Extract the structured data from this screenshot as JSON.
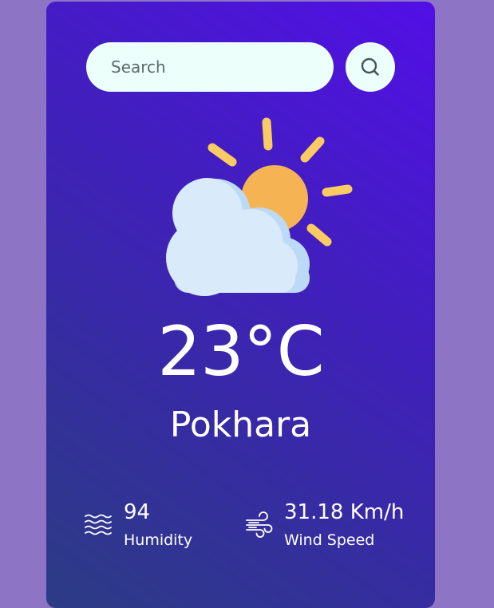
{
  "search": {
    "placeholder": "Search",
    "value": ""
  },
  "weather": {
    "icon": "partly-cloudy-sun-icon",
    "temperature": "23°C",
    "city": "Pokhara"
  },
  "details": {
    "humidity": {
      "value": "94",
      "label": "Humidity",
      "icon": "humidity-waves-icon"
    },
    "wind": {
      "value": "31.18 Km/h",
      "label": "Wind Speed",
      "icon": "wind-icon"
    }
  },
  "colors": {
    "page_background": "#8e74c4",
    "card_gradient_top": "#520fe6",
    "card_gradient_bottom": "#2c3c84",
    "input_background": "#ecfffb",
    "sun": "#f6b353",
    "sun_rays": "#fbcb63",
    "cloud": "#d9ebfb",
    "cloud_shadow": "#bcdaf6",
    "text": "#ffffff"
  }
}
